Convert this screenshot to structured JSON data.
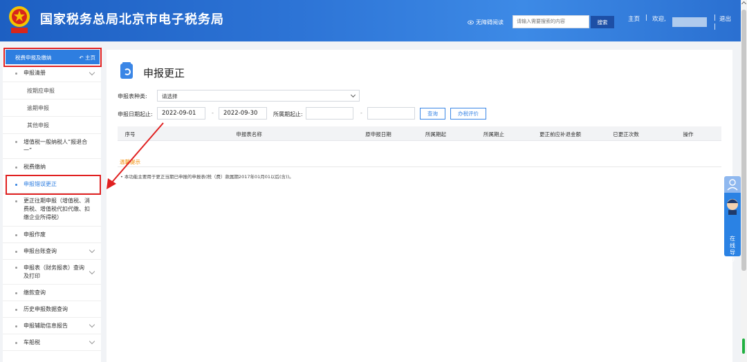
{
  "header": {
    "site_title": "国家税务总局北京市电子税务局",
    "accessibility": "无障碍阅读",
    "search_placeholder": "请输入需要搜索的内容",
    "search_button": "搜索",
    "home": "主页",
    "welcome": "欢迎,",
    "logout": "退出",
    "separator": "|"
  },
  "sidebar": {
    "header_title": "税费申报及缴纳",
    "header_home": "主页",
    "items": [
      {
        "label": "申报清册"
      },
      {
        "label": "按期应申报"
      },
      {
        "label": "逾期申报"
      },
      {
        "label": "其他申报"
      },
      {
        "label": "增值税一般纳税人“报退合一”"
      },
      {
        "label": "税费缴纳"
      },
      {
        "label": "申报错误更正"
      },
      {
        "label": "更正往期申报（增值税、消费税、增值税代扣代缴、扣缴企业所得税）"
      },
      {
        "label": "申报作废"
      },
      {
        "label": "申报台账查询"
      },
      {
        "label": "申报表（财务报表）查询及打印"
      },
      {
        "label": "缴款查询"
      },
      {
        "label": "历史申报数据查询"
      },
      {
        "label": "申报辅助信息报告"
      },
      {
        "label": "车船税"
      }
    ]
  },
  "main": {
    "title": "申报更正",
    "form_type_label": "申报表种类:",
    "form_type_value": "请选择",
    "date_label": "申报日期起止:",
    "date_start": "2022-09-01",
    "date_end": "2022-09-30",
    "dash": "-",
    "period_label": "所属期起止:",
    "period_start": "",
    "period_end": "",
    "query_button": "查询",
    "evaluate_button": "办税评价",
    "table_headers": [
      "序号",
      "申报表名称",
      "原申报日期",
      "所属期起",
      "所属期止",
      "更正前应补退金额",
      "已更正次数",
      "操作"
    ],
    "tips_title": "温馨提示",
    "tips_text": "• 本功能主要用于更正当期已申报的申报表(税（费）款属期2017年01月01以后(含))。"
  },
  "float_guide": {
    "label": "在线导办"
  },
  "colors": {
    "header_blue": "#2d74d6",
    "accent_blue": "#2e7ee0",
    "highlight_red": "#e02020",
    "tips_orange": "#f08a00"
  }
}
